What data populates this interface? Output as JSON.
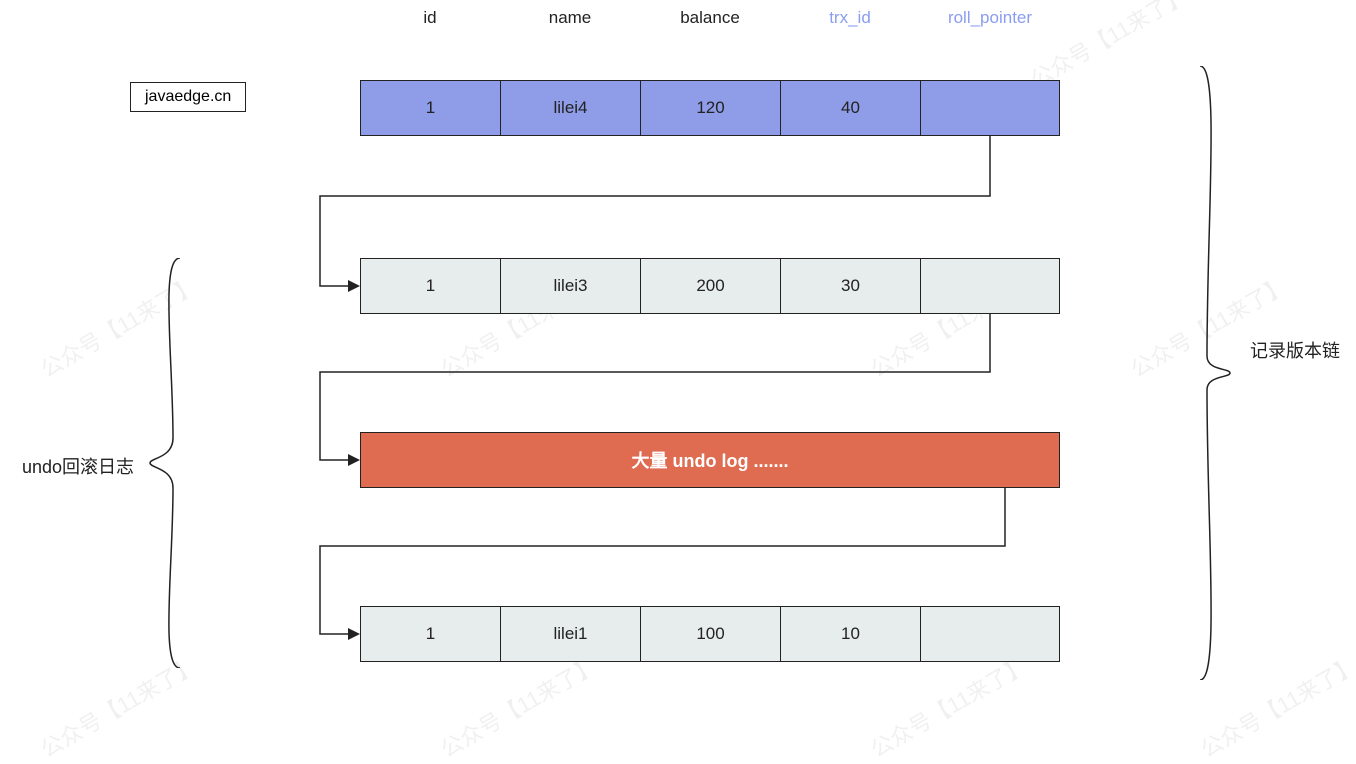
{
  "watermark_text": "公众号【11来了】",
  "javaedge": "javaedge.cn",
  "headers": {
    "id": "id",
    "name": "name",
    "balance": "balance",
    "trx_id": "trx_id",
    "roll_pointer": "roll_pointer"
  },
  "rows": {
    "r1": {
      "id": "1",
      "name": "lilei4",
      "balance": "120",
      "trx_id": "40",
      "roll_pointer": ""
    },
    "r2": {
      "id": "1",
      "name": "lilei3",
      "balance": "200",
      "trx_id": "30",
      "roll_pointer": ""
    },
    "r3_text": "大量 undo log .......",
    "r4": {
      "id": "1",
      "name": "lilei1",
      "balance": "100",
      "trx_id": "10",
      "roll_pointer": ""
    }
  },
  "labels": {
    "undo_log": "undo回滚日志",
    "version_chain": "记录版本链"
  }
}
